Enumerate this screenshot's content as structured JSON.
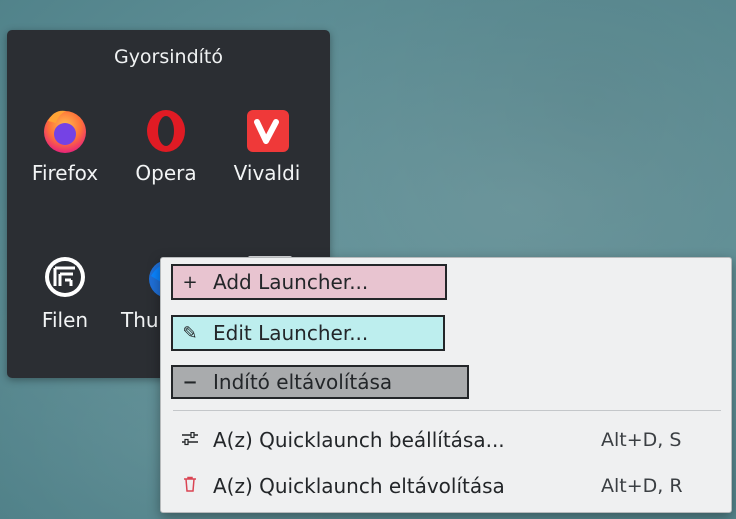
{
  "panel": {
    "title": "Gyorsindító",
    "launchers": [
      {
        "label": "Firefox",
        "icon": "firefox-icon"
      },
      {
        "label": "Opera",
        "icon": "opera-icon"
      },
      {
        "label": "Vivaldi",
        "icon": "vivaldi-icon"
      },
      {
        "label": "Filen",
        "icon": "filen-icon"
      },
      {
        "label": "Thu",
        "icon": "thunderbird-icon"
      }
    ]
  },
  "menu": {
    "items": [
      {
        "label": "Add Launcher...",
        "icon": "plus-icon",
        "shortcut": ""
      },
      {
        "label": "Edit Launcher...",
        "icon": "pencil-icon",
        "shortcut": ""
      },
      {
        "label": "Indító eltávolítása",
        "icon": "minus-icon",
        "shortcut": ""
      },
      {
        "label": "A(z) Quicklaunch beállítása...",
        "icon": "configure-icon",
        "shortcut": "Alt+D, S"
      },
      {
        "label": "A(z) Quicklaunch eltávolítása",
        "icon": "trash-icon",
        "shortcut": "Alt+D, R"
      }
    ]
  },
  "colors": {
    "panel_bg": "#2b2e33",
    "menu_bg": "#eff0f1",
    "highlight_add": "#e8c4d0",
    "highlight_edit": "#bdeeee",
    "highlight_remove": "#a9abad",
    "trash_red": "#da4453"
  }
}
